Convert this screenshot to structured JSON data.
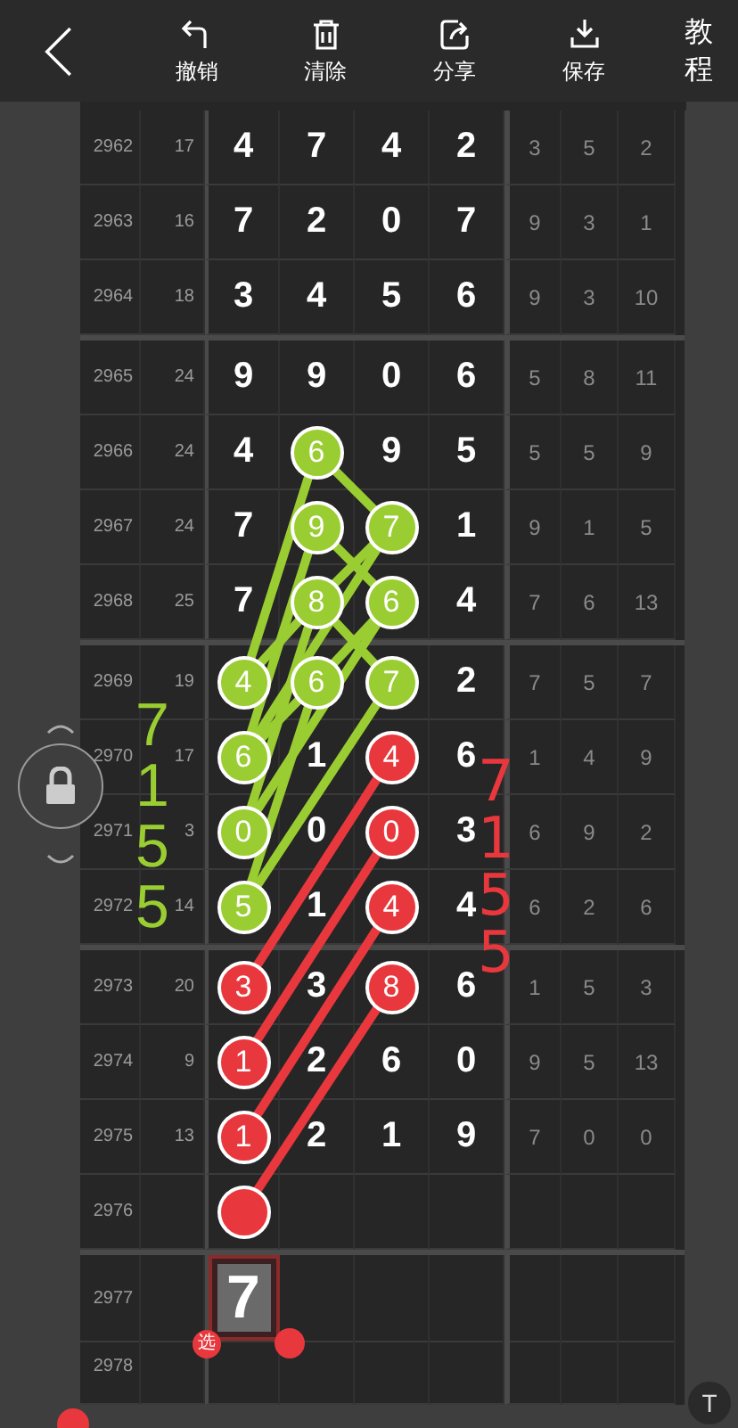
{
  "header": {
    "tools": [
      {
        "kind": "undo",
        "label": "撤销"
      },
      {
        "kind": "clear",
        "label": "清除"
      },
      {
        "kind": "share",
        "label": "分享"
      },
      {
        "kind": "save",
        "label": "保存"
      }
    ],
    "help": "教程"
  },
  "rows": [
    {
      "issue": "2962",
      "sum": "17",
      "digits": [
        {
          "value": "4"
        },
        {
          "value": "7"
        },
        {
          "value": "4"
        },
        {
          "value": "2"
        }
      ],
      "stats": [
        "3",
        "5",
        "2"
      ]
    },
    {
      "issue": "2963",
      "sum": "16",
      "digits": [
        {
          "value": "7"
        },
        {
          "value": "2"
        },
        {
          "value": "0"
        },
        {
          "value": "7"
        }
      ],
      "stats": [
        "9",
        "3",
        "1"
      ]
    },
    {
      "issue": "2964",
      "sum": "18",
      "digits": [
        {
          "value": "3"
        },
        {
          "value": "4"
        },
        {
          "value": "5"
        },
        {
          "value": "6"
        }
      ],
      "stats": [
        "9",
        "3",
        "10"
      ]
    },
    {
      "issue": "2965",
      "sum": "24",
      "digits": [
        {
          "value": "9"
        },
        {
          "value": "9"
        },
        {
          "value": "0"
        },
        {
          "value": "6"
        }
      ],
      "stats": [
        "5",
        "8",
        "11"
      ]
    },
    {
      "issue": "2966",
      "sum": "24",
      "digits": [
        {
          "value": "4"
        },
        {
          "value": "6",
          "color": "#9acd32"
        },
        {
          "value": "9"
        },
        {
          "value": "5"
        }
      ],
      "stats": [
        "5",
        "5",
        "9"
      ]
    },
    {
      "issue": "2967",
      "sum": "24",
      "digits": [
        {
          "value": "7"
        },
        {
          "value": "9",
          "color": "#9acd32"
        },
        {
          "value": "7",
          "color": "#9acd32"
        },
        {
          "value": "1"
        }
      ],
      "stats": [
        "9",
        "1",
        "5"
      ]
    },
    {
      "issue": "2968",
      "sum": "25",
      "digits": [
        {
          "value": "7"
        },
        {
          "value": "8",
          "color": "#9acd32"
        },
        {
          "value": "6",
          "color": "#9acd32"
        },
        {
          "value": "4"
        }
      ],
      "stats": [
        "7",
        "6",
        "13"
      ]
    },
    {
      "issue": "2969",
      "sum": "19",
      "digits": [
        {
          "value": "4",
          "color": "#9acd32"
        },
        {
          "value": "6",
          "color": "#9acd32"
        },
        {
          "value": "7",
          "color": "#9acd32"
        },
        {
          "value": "2"
        }
      ],
      "stats": [
        "7",
        "5",
        "7"
      ]
    },
    {
      "issue": "2970",
      "sum": "17",
      "digits": [
        {
          "value": "6",
          "color": "#9acd32"
        },
        {
          "value": "1"
        },
        {
          "value": "4",
          "color": "#e8383d"
        },
        {
          "value": "6"
        }
      ],
      "stats": [
        "1",
        "4",
        "9"
      ]
    },
    {
      "issue": "2971",
      "sum": "3",
      "digits": [
        {
          "value": "0",
          "color": "#9acd32"
        },
        {
          "value": "0"
        },
        {
          "value": "0",
          "color": "#e8383d"
        },
        {
          "value": "3"
        }
      ],
      "stats": [
        "6",
        "9",
        "2"
      ]
    },
    {
      "issue": "2972",
      "sum": "14",
      "digits": [
        {
          "value": "5",
          "color": "#9acd32"
        },
        {
          "value": "1"
        },
        {
          "value": "4",
          "color": "#e8383d"
        },
        {
          "value": "4"
        }
      ],
      "stats": [
        "6",
        "2",
        "6"
      ]
    },
    {
      "issue": "2973",
      "sum": "20",
      "digits": [
        {
          "value": "3",
          "color": "#e8383d"
        },
        {
          "value": "3"
        },
        {
          "value": "8",
          "color": "#e8383d"
        },
        {
          "value": "6"
        }
      ],
      "stats": [
        "1",
        "5",
        "3"
      ]
    },
    {
      "issue": "2974",
      "sum": "9",
      "digits": [
        {
          "value": "1",
          "color": "#e8383d"
        },
        {
          "value": "2"
        },
        {
          "value": "6"
        },
        {
          "value": "0"
        }
      ],
      "stats": [
        "9",
        "5",
        "13"
      ]
    },
    {
      "issue": "2975",
      "sum": "13",
      "digits": [
        {
          "value": "1",
          "color": "#e8383d"
        },
        {
          "value": "2"
        },
        {
          "value": "1"
        },
        {
          "value": "9"
        }
      ],
      "stats": [
        "7",
        "0",
        "0"
      ]
    },
    {
      "issue": "2976",
      "digits": [
        {
          "color": "#e8383d"
        }
      ]
    },
    {
      "issue": "2977",
      "picker": {
        "value": "7",
        "badge": "选"
      }
    },
    {
      "issue": "2978"
    }
  ],
  "annotations": [
    {
      "text": "7155",
      "color": "#9acd32"
    },
    {
      "text": "7155",
      "color": "#e8383d"
    }
  ],
  "tool_button": "T"
}
